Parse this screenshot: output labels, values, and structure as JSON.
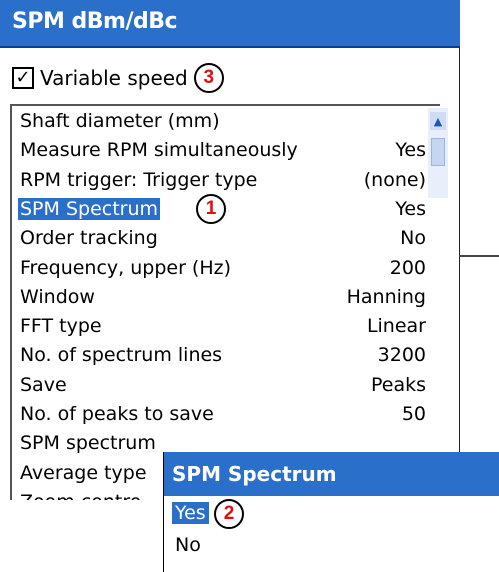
{
  "window": {
    "title": "SPM dBm/dBc"
  },
  "variable_speed": {
    "label": "Variable speed",
    "checked": true,
    "check_glyph": "✓",
    "callout": "3"
  },
  "parameters": [
    {
      "label": "Shaft diameter (mm)",
      "value": ""
    },
    {
      "label": "Measure RPM simultaneously",
      "value": "Yes"
    },
    {
      "label": "RPM trigger: Trigger type",
      "value": "(none)"
    },
    {
      "label": "SPM Spectrum",
      "value": "Yes",
      "selected": true,
      "callout": "1"
    },
    {
      "label": "Order tracking",
      "value": "No"
    },
    {
      "label": "Frequency, upper (Hz)",
      "value": "200"
    },
    {
      "label": "Window",
      "value": "Hanning"
    },
    {
      "label": "FFT type",
      "value": "Linear"
    },
    {
      "label": "No. of spectrum lines",
      "value": "3200"
    },
    {
      "label": "Save",
      "value": "Peaks"
    },
    {
      "label": "No. of peaks to save",
      "value": "50"
    },
    {
      "label": "SPM spectrum",
      "value": ""
    },
    {
      "label": "Average type",
      "value": ""
    },
    {
      "label": "Zoom contro",
      "value": ""
    }
  ],
  "popup": {
    "title": "SPM Spectrum",
    "options": [
      {
        "label": "Yes",
        "selected": true,
        "callout": "2"
      },
      {
        "label": "No",
        "selected": false
      }
    ]
  },
  "colors": {
    "accent": "#2a6fc9",
    "callout_text": "#e01010"
  },
  "icons": {
    "scroll_up": "scroll-up-arrow-icon",
    "checkbox": "checkmark-icon"
  }
}
